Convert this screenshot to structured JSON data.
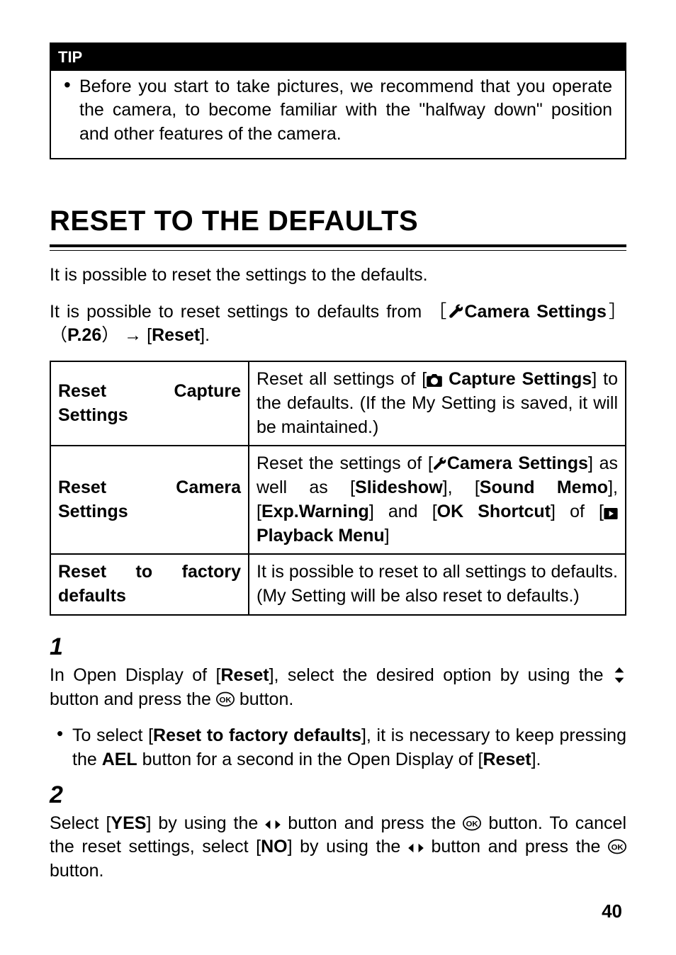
{
  "tip": {
    "header": "TIP",
    "body": "Before you start to take pictures, we recommend that you operate the camera, to become familiar with the \"halfway down\" position and other features of the camera."
  },
  "section_title": "RESET TO THE DEFAULTS",
  "para1": "It is possible to reset the settings to the defaults.",
  "para2_pre": "It is possible to reset settings to defaults from ［",
  "para2_bold1": "Camera Settings",
  "para2_mid1": "］（",
  "para2_bold2": "P.26",
  "para2_mid2": "） → [",
  "para2_bold3": "Reset",
  "para2_post": "].",
  "table": {
    "rows": [
      {
        "label": "Reset Capture Settings",
        "desc_pre": "Reset all settings of [",
        "desc_bold1": " Capture Settings",
        "desc_post": "] to the defaults. (If the My Setting is saved, it will be maintained.)"
      },
      {
        "label": "Reset Camera Settings",
        "desc_pre": "Reset the settings of [",
        "desc_bold1": "Camera Settings",
        "desc_mid1": "] as well as [",
        "desc_bold2": "Slideshow",
        "desc_mid2": "], [",
        "desc_bold3": "Sound Memo",
        "desc_mid3": "], [",
        "desc_bold4": "Exp.Warning",
        "desc_mid4": "] and [",
        "desc_bold5": "OK Shortcut",
        "desc_mid5": "] of [",
        "desc_bold6": " Playback Menu",
        "desc_post": "]"
      },
      {
        "label": "Reset to factory defaults",
        "desc": "It is possible to reset to all settings to defaults. (My Setting will be also reset to defaults.)"
      }
    ]
  },
  "step1": {
    "num": "1",
    "pre": "In Open Display of [",
    "bold1": "Reset",
    "mid": "], select the desired option by using the ",
    "post": " button and press the ",
    "post2": " button."
  },
  "bullet1": {
    "pre": "To select [",
    "bold1": "Reset to factory defaults",
    "mid1": "], it is necessary to keep pressing the ",
    "ael": "AEL",
    "mid2": " button for a second in the Open Display of [",
    "bold2": "Reset",
    "post": "]."
  },
  "step2": {
    "num": "2",
    "pre": "Select [",
    "bold1": "YES",
    "mid1": "] by using the ",
    "mid2": " button and press the ",
    "mid3": " button. To cancel the reset settings, select [",
    "bold2": "NO",
    "mid4": "] by using the ",
    "mid5": " button and press the ",
    "post": " button."
  },
  "page": "40"
}
